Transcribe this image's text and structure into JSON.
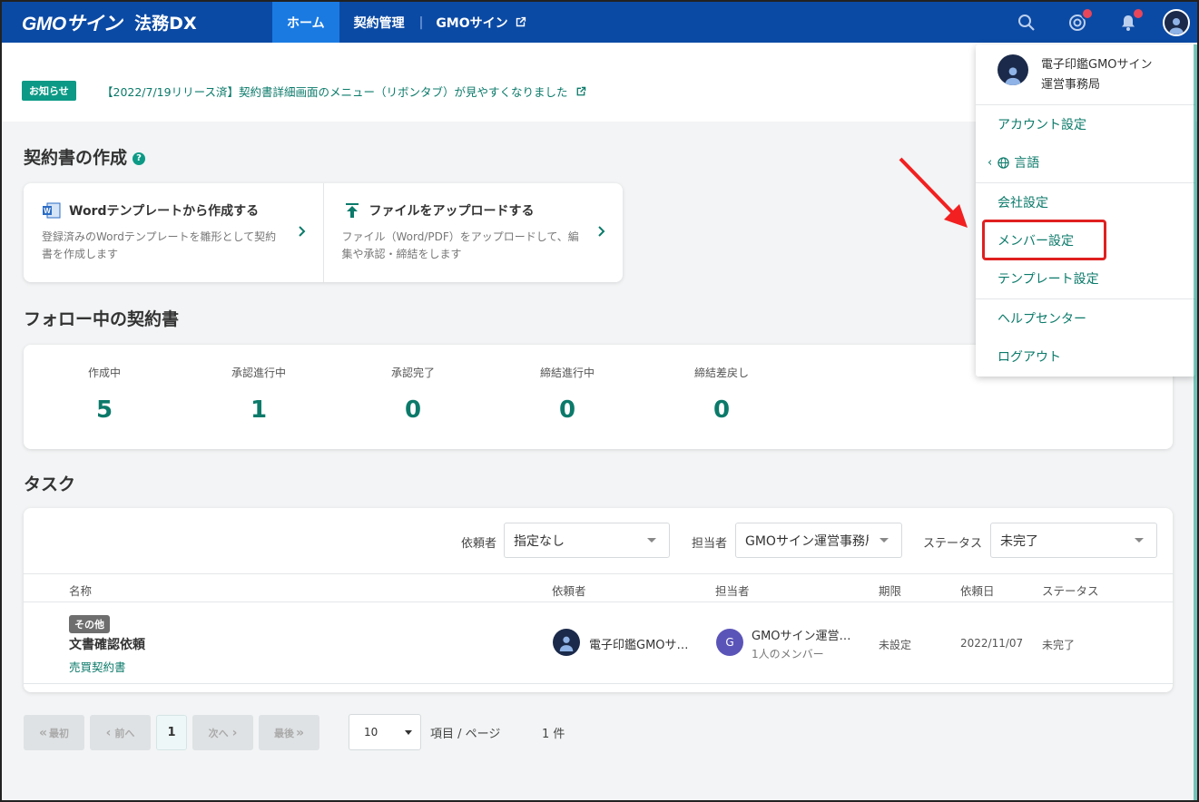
{
  "header": {
    "logo_text": "GMOサイン",
    "logo_sub": "法務DX",
    "nav": {
      "home": "ホーム",
      "contract": "契約管理",
      "separator": "|",
      "gmosign": "GMOサイン"
    },
    "icons": [
      "search-icon",
      "mention-icon",
      "bell-icon",
      "user-avatar-icon"
    ],
    "accent": "#0b4aa4"
  },
  "notice": {
    "badge": "お知らせ",
    "text": "【2022/7/19リリース済】契約書詳細画面のメニュー（リボンタブ）が見やすくなりました"
  },
  "create": {
    "title": "契約書の作成",
    "options": [
      {
        "title": "Wordテンプレートから作成する",
        "desc": "登録済みのWordテンプレートを雛形として契約書を作成します"
      },
      {
        "title": "ファイルをアップロードする",
        "desc": "ファイル（Word/PDF）をアップロードして、編集や承認・締結をします"
      }
    ]
  },
  "follow": {
    "title": "フォロー中の契約書",
    "stats": [
      {
        "label": "作成中",
        "value": "5"
      },
      {
        "label": "承認進行中",
        "value": "1"
      },
      {
        "label": "承認完了",
        "value": "0"
      },
      {
        "label": "締結進行中",
        "value": "0"
      },
      {
        "label": "締結差戻し",
        "value": "0"
      }
    ]
  },
  "tasks": {
    "title": "タスク",
    "filters": {
      "requester_label": "依頼者",
      "requester_value": "指定なし",
      "assignee_label": "担当者",
      "assignee_value": "GMOサイン運営事務局",
      "status_label": "ステータス",
      "status_value": "未完了"
    },
    "columns": {
      "name": "名称",
      "requester": "依頼者",
      "assignee": "担当者",
      "deadline": "期限",
      "request_date": "依頼日",
      "status": "ステータス"
    },
    "rows": [
      {
        "tag": "その他",
        "title": "文書確認依頼",
        "doc": "売買契約書",
        "requester": "電子印鑑GMOサ…",
        "assignee_initial": "G",
        "assignee": "GMOサイン運営…",
        "assignee_sub": "1人のメンバー",
        "deadline": "未設定",
        "request_date": "2022/11/07",
        "status": "未完了"
      }
    ]
  },
  "pagination": {
    "first": "最初",
    "prev": "前へ",
    "current": "1",
    "next": "次へ",
    "last": "最後",
    "per_page": "10",
    "per_page_label": "項目 / ページ",
    "total": "1 件"
  },
  "menu": {
    "user_name_1": "電子印鑑GMOサイン",
    "user_name_2": "運営事務局",
    "account": "アカウント設定",
    "language": "言語",
    "company": "会社設定",
    "member": "メンバー設定",
    "template": "テンプレート設定",
    "help": "ヘルプセンター",
    "logout": "ログアウト"
  }
}
